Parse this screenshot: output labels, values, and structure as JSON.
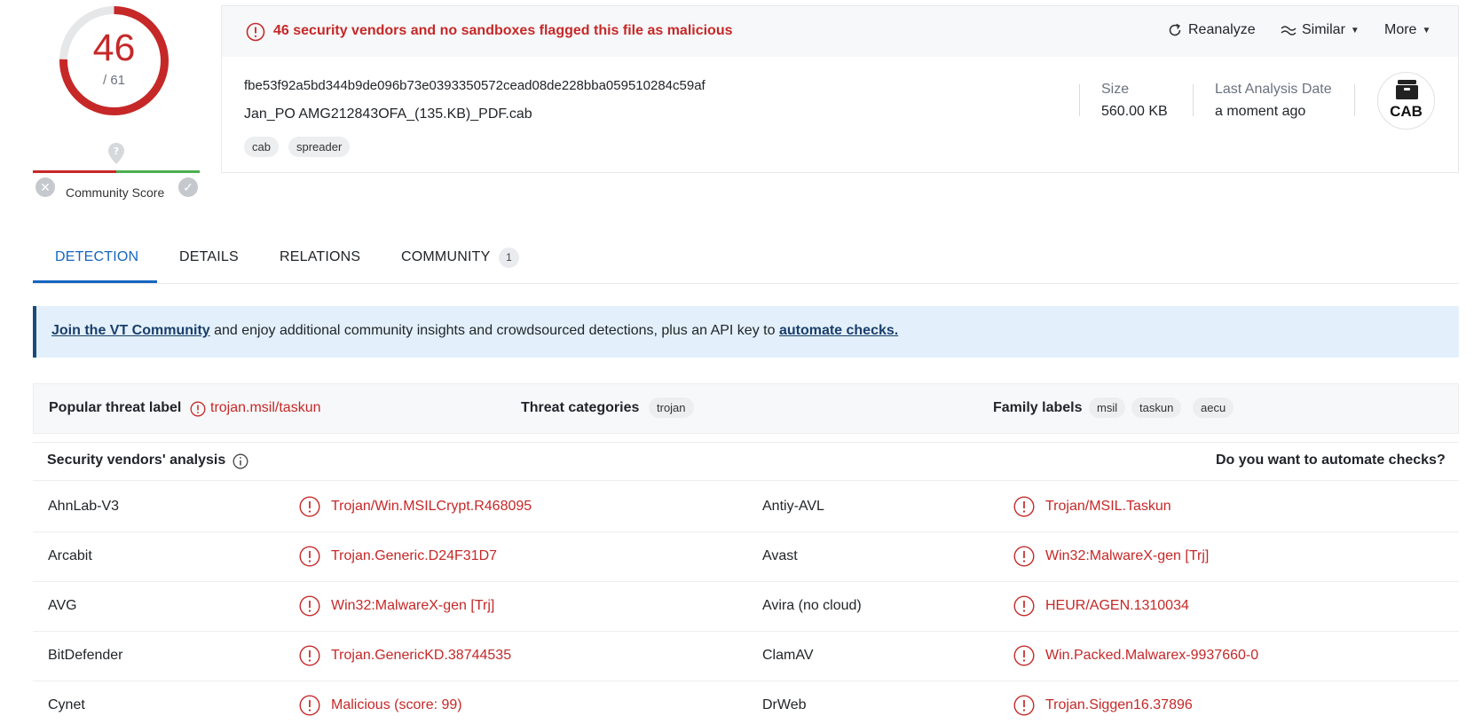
{
  "score": {
    "detections": "46",
    "total": "/ 61",
    "fraction": 0.754
  },
  "community": {
    "label": "Community Score"
  },
  "summary": {
    "alert": "46 security vendors and no sandboxes flagged this file as malicious",
    "actions": {
      "reanalyze": "Reanalyze",
      "similar": "Similar",
      "more": "More"
    },
    "hash": "fbe53f92a5bd344b9de096b73e0393350572cead08de228bba059510284c59af",
    "filename": "Jan_PO AMG212843OFA_(135.KB)_PDF.cab",
    "tags": [
      "cab",
      "spreader"
    ],
    "size_label": "Size",
    "size_value": "560.00 KB",
    "date_label": "Last Analysis Date",
    "date_value": "a moment ago",
    "filetype": "CAB"
  },
  "tabs": [
    {
      "label": "DETECTION",
      "active": true
    },
    {
      "label": "DETAILS"
    },
    {
      "label": "RELATIONS"
    },
    {
      "label": "COMMUNITY",
      "badge": "1"
    }
  ],
  "banner": {
    "link1": "Join the VT Community",
    "middle": " and enjoy additional community insights and crowdsourced detections, plus an API key to ",
    "link2": "automate checks."
  },
  "threat": {
    "popular_label": "Popular threat label",
    "popular_value": "trojan.msil/taskun",
    "categories_label": "Threat categories",
    "categories": [
      "trojan"
    ],
    "family_label": "Family labels",
    "families": [
      "msil",
      "taskun",
      "aecu"
    ]
  },
  "vendors": {
    "title": "Security vendors' analysis",
    "automate": "Do you want to automate checks?",
    "rows": [
      [
        {
          "name": "AhnLab-V3",
          "result": "Trojan/Win.MSILCrypt.R468095"
        },
        {
          "name": "Antiy-AVL",
          "result": "Trojan/MSIL.Taskun"
        }
      ],
      [
        {
          "name": "Arcabit",
          "result": "Trojan.Generic.D24F31D7"
        },
        {
          "name": "Avast",
          "result": "Win32:MalwareX-gen [Trj]"
        }
      ],
      [
        {
          "name": "AVG",
          "result": "Win32:MalwareX-gen [Trj]"
        },
        {
          "name": "Avira (no cloud)",
          "result": "HEUR/AGEN.1310034"
        }
      ],
      [
        {
          "name": "BitDefender",
          "result": "Trojan.GenericKD.38744535"
        },
        {
          "name": "ClamAV",
          "result": "Win.Packed.Malwarex-9937660-0"
        }
      ],
      [
        {
          "name": "Cynet",
          "result": "Malicious (score: 99)"
        },
        {
          "name": "DrWeb",
          "result": "Trojan.Siggen16.37896"
        }
      ]
    ]
  },
  "colors": {
    "malicious": "#c62828",
    "accent": "#1565c0",
    "clean": "#4caf50"
  }
}
